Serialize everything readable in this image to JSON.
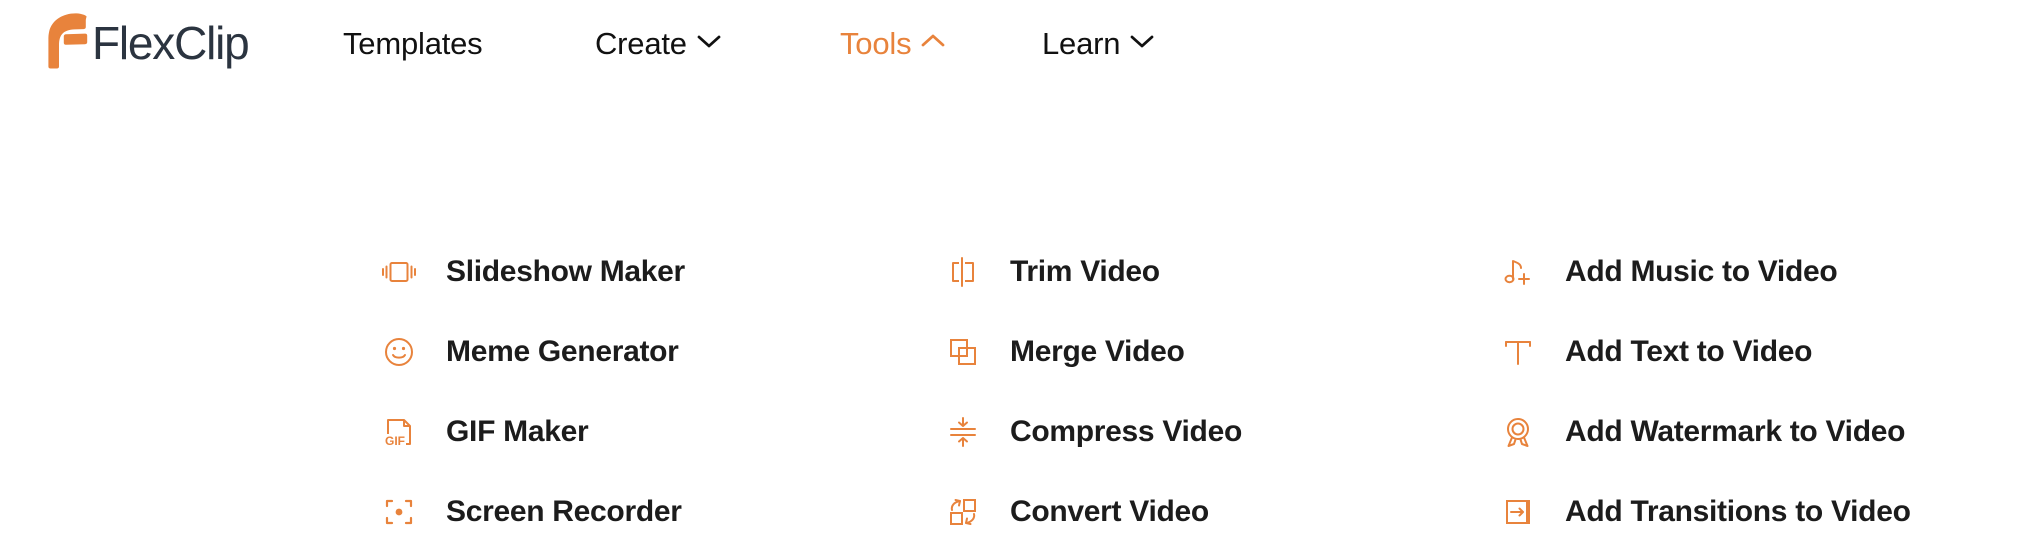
{
  "brand": {
    "name": "FlexClip",
    "logo_icon": "flexclip-f-mark",
    "accent_color": "#e8833c",
    "wordmark_color": "#2b3440"
  },
  "header": {
    "nav": [
      {
        "label": "Templates",
        "has_caret": false,
        "caret_icon": "",
        "active": false
      },
      {
        "label": "Create",
        "has_caret": true,
        "caret_icon": "chevron-down-icon",
        "active": false
      },
      {
        "label": "Tools",
        "has_caret": true,
        "caret_icon": "chevron-up-icon",
        "active": true
      },
      {
        "label": "Learn",
        "has_caret": true,
        "caret_icon": "chevron-down-icon",
        "active": false
      }
    ]
  },
  "dropdown": {
    "open_for": "Tools",
    "columns": [
      {
        "items": [
          {
            "label": "Slideshow Maker",
            "icon": "slideshow-icon"
          },
          {
            "label": "Meme Generator",
            "icon": "smiley-face-icon"
          },
          {
            "label": "GIF Maker",
            "icon": "gif-file-icon"
          },
          {
            "label": "Screen Recorder",
            "icon": "screen-record-icon"
          }
        ]
      },
      {
        "items": [
          {
            "label": "Trim Video",
            "icon": "trim-icon"
          },
          {
            "label": "Merge Video",
            "icon": "merge-squares-icon"
          },
          {
            "label": "Compress Video",
            "icon": "compress-arrows-icon"
          },
          {
            "label": "Convert Video",
            "icon": "convert-squares-icon"
          }
        ]
      },
      {
        "items": [
          {
            "label": "Add Music to Video",
            "icon": "music-note-plus-icon"
          },
          {
            "label": "Add Text to Video",
            "icon": "text-t-icon"
          },
          {
            "label": "Add Watermark to Video",
            "icon": "watermark-badge-icon"
          },
          {
            "label": "Add Transitions to Video",
            "icon": "transition-arrow-icon"
          }
        ]
      }
    ]
  }
}
